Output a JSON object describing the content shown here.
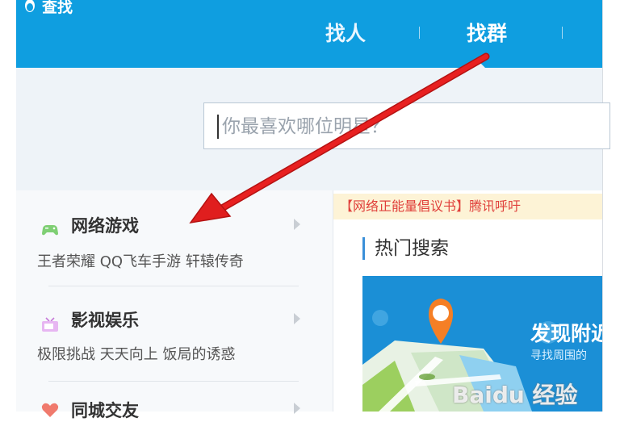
{
  "app": {
    "title": "查找"
  },
  "tabs": [
    {
      "label": "找人",
      "active": false
    },
    {
      "label": "找群",
      "active": true
    }
  ],
  "search": {
    "placeholder": "你最喜欢哪位明星？"
  },
  "categories": [
    {
      "title": "网络游戏",
      "icon": "gamepad-icon",
      "subs": "王者荣耀  QQ飞车手游  轩辕传奇"
    },
    {
      "title": "影视娱乐",
      "icon": "tv-icon",
      "subs": "极限挑战  天天向上  饭局的诱惑"
    },
    {
      "title": "同城交友",
      "icon": "heart-icon",
      "subs": ""
    }
  ],
  "notice": {
    "text": "【网络正能量倡议书】腾讯呼吁"
  },
  "hot": {
    "title": "热门搜索"
  },
  "banner": {
    "title": "发现附近",
    "subtitle": "寻找周围的"
  },
  "watermark": {
    "text": "Baidu 经验"
  },
  "colors": {
    "topbar": "#0f9ee0",
    "accent_arrow": "#e01e1e",
    "notice_text": "#e0403b"
  }
}
